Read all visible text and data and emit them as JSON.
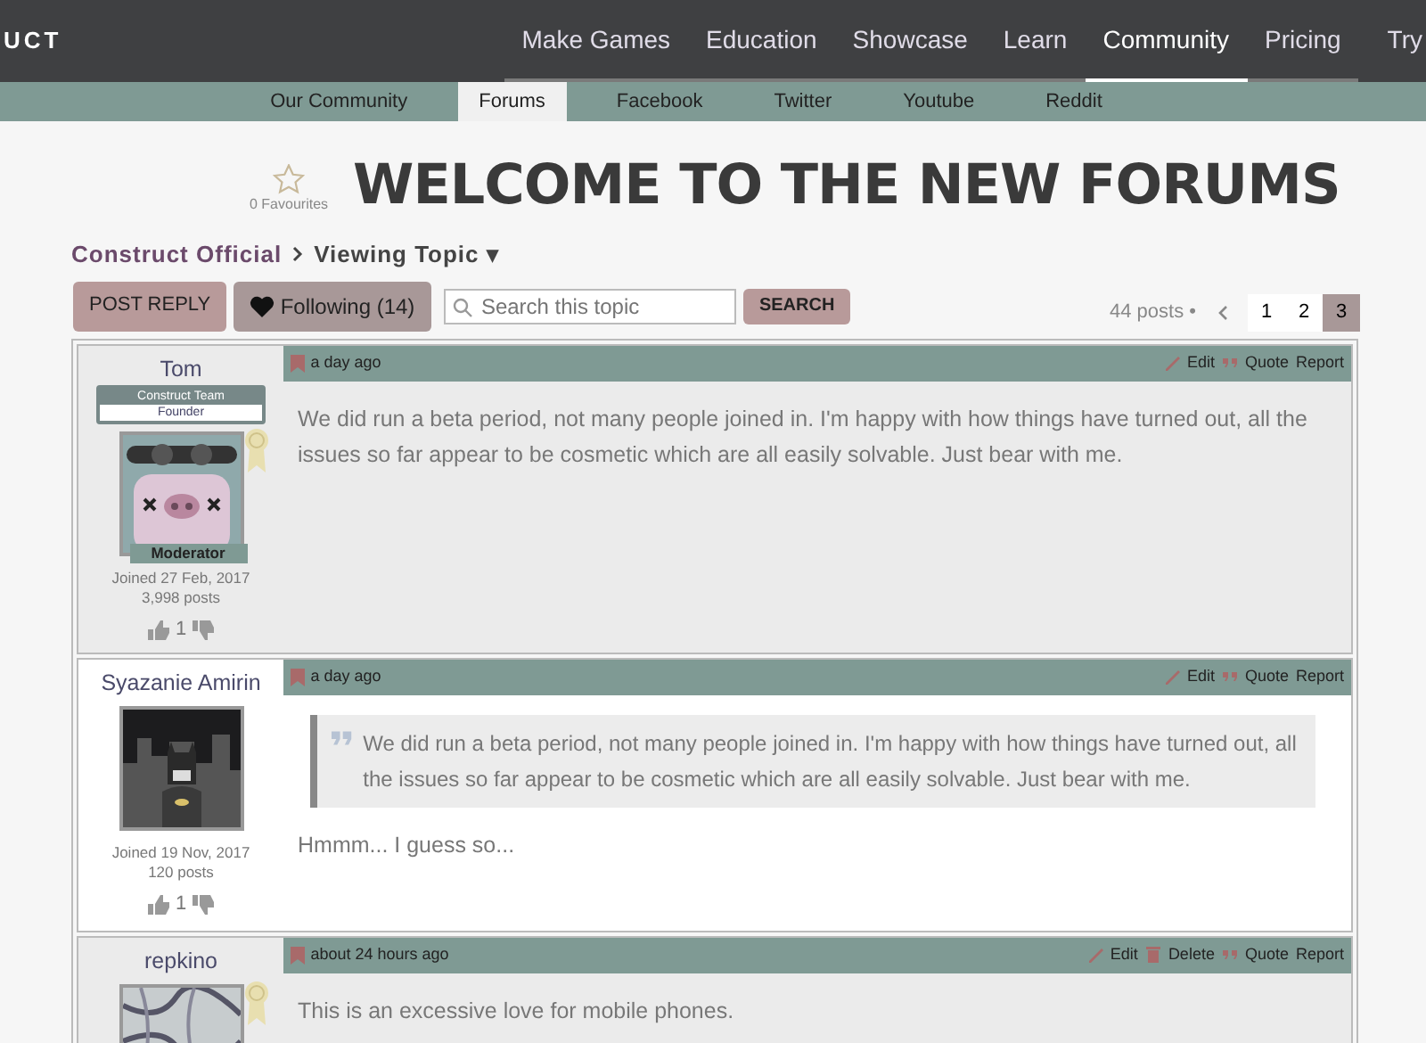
{
  "brand": {
    "text": "UCT"
  },
  "nav": [
    {
      "label": "Make Games",
      "selected": false
    },
    {
      "label": "Education",
      "selected": false
    },
    {
      "label": "Showcase",
      "selected": false
    },
    {
      "label": "Learn",
      "selected": false
    },
    {
      "label": "Community",
      "selected": true
    },
    {
      "label": "Pricing",
      "selected": false
    },
    {
      "label": "Try",
      "selected": false
    }
  ],
  "subnav": [
    {
      "label": "Our Community",
      "selected": false
    },
    {
      "label": "Forums",
      "selected": true
    },
    {
      "label": "Facebook",
      "selected": false
    },
    {
      "label": "Twitter",
      "selected": false
    },
    {
      "label": "Youtube",
      "selected": false
    },
    {
      "label": "Reddit",
      "selected": false
    }
  ],
  "favourites": {
    "count": "0 Favourites"
  },
  "title": "WELCOME TO THE NEW FORUMS",
  "breadcrumb": {
    "parent": "Construct Official",
    "current": "Viewing Topic",
    "caret": "▾"
  },
  "toolbar": {
    "post_reply": "POST REPLY",
    "following": "Following (14)",
    "search": {
      "placeholder": "Search this topic"
    },
    "search_button": "SEARCH"
  },
  "pagination": {
    "count": "44 posts •",
    "pages": [
      {
        "label": "1",
        "selected": false
      },
      {
        "label": "2",
        "selected": false
      },
      {
        "label": "3",
        "selected": true
      }
    ]
  },
  "posts": [
    {
      "author": "Tom",
      "team": "Construct Team",
      "role": "Founder",
      "rank": "Moderator",
      "avatar": {
        "kind": "pig"
      },
      "award": true,
      "joined": "Joined 27 Feb, 2017",
      "post_count": "3,998 posts",
      "likes": "1",
      "time": "a day ago",
      "actions": [
        {
          "kind": "edit",
          "label": "Edit"
        },
        {
          "kind": "quote",
          "label": "Quote"
        },
        {
          "kind": "report",
          "label": "Report"
        }
      ],
      "body": "We did run a beta period, not many people joined in. I'm happy with how things have turned out, all the issues so far appear to be cosmetic which are all easily solvable. Just bear with me."
    },
    {
      "author": "Syazanie Amirin",
      "avatar": {
        "kind": "figure"
      },
      "award": false,
      "joined": "Joined 19 Nov, 2017",
      "post_count": "120 posts",
      "likes": "1",
      "time": "a day ago",
      "actions": [
        {
          "kind": "edit",
          "label": "Edit"
        },
        {
          "kind": "quote",
          "label": "Quote"
        },
        {
          "kind": "report",
          "label": "Report"
        }
      ],
      "quote": "We did run a beta period, not many people joined in. I'm happy with how things have turned out, all the issues so far appear to be cosmetic which are all easily solvable. Just bear with me.",
      "body": "Hmmm... I guess so..."
    },
    {
      "author": "repkino",
      "avatar": {
        "kind": "pattern"
      },
      "award": true,
      "time": "about 24 hours ago",
      "actions": [
        {
          "kind": "edit",
          "label": "Edit"
        },
        {
          "kind": "delete",
          "label": "Delete"
        },
        {
          "kind": "quote",
          "label": "Quote"
        },
        {
          "kind": "report",
          "label": "Report"
        }
      ],
      "body": "This is an excessive love for mobile phones."
    }
  ]
}
